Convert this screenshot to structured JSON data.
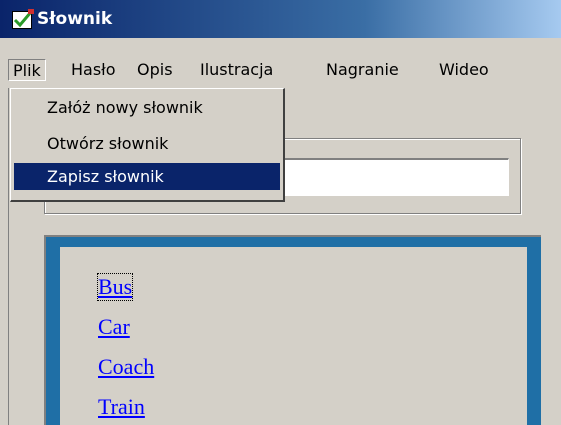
{
  "window": {
    "title": "Słownik",
    "icon": "dictionary-app-icon"
  },
  "menubar": {
    "items": [
      "Plik",
      "Hasło",
      "Opis",
      "Ilustracja",
      "Nagranie",
      "Wideo"
    ],
    "open_menu": "Plik"
  },
  "file_menu": {
    "items": [
      "Załóż nowy słownik",
      "Otwórz słownik",
      "Zapisz słownik"
    ],
    "selected": "Zapisz słownik"
  },
  "search": {
    "value": ""
  },
  "word_list": {
    "items": [
      "Bus",
      "Car",
      "Coach",
      "Train"
    ],
    "focused": "Bus"
  },
  "colors": {
    "titlebar_start": "#0a246a",
    "titlebar_end": "#a6caf0",
    "panel_border": "#1f6fa6",
    "link": "#0000ff",
    "selection": "#0a246a"
  }
}
